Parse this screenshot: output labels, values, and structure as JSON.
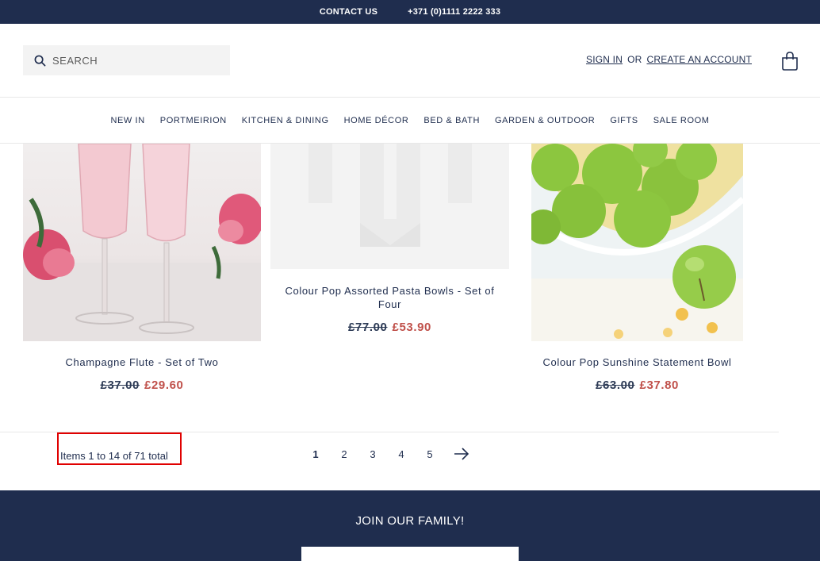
{
  "topbar": {
    "contact_label": "CONTACT US",
    "phone": "+371 (0)1111 2222 333"
  },
  "header": {
    "search_placeholder": "SEARCH",
    "sign_in": "SIGN IN",
    "or": "OR",
    "create_account": "CREATE AN ACCOUNT"
  },
  "nav": [
    "NEW IN",
    "PORTMEIRION",
    "KITCHEN & DINING",
    "HOME DÉCOR",
    "BED & BATH",
    "GARDEN & OUTDOOR",
    "GIFTS",
    "SALE ROOM"
  ],
  "products": [
    {
      "name": "Champagne Flute - Set of Two",
      "old_price": "£37.00",
      "new_price": "£29.60"
    },
    {
      "name": "Colour Pop Assorted Pasta Bowls - Set of Four",
      "old_price": "£77.00",
      "new_price": "£53.90"
    },
    {
      "name": "Colour Pop Sunshine Statement Bowl",
      "old_price": "£63.00",
      "new_price": "£37.80"
    }
  ],
  "pagination": {
    "summary": "Items 1 to 14 of 71 total",
    "pages": [
      "1",
      "2",
      "3",
      "4",
      "5"
    ],
    "current_page": "1"
  },
  "footer": {
    "title": "JOIN OUR FAMILY!"
  },
  "colors": {
    "navy": "#1f2d4e",
    "sale_red": "#c0514b",
    "highlight": "#e00000"
  }
}
